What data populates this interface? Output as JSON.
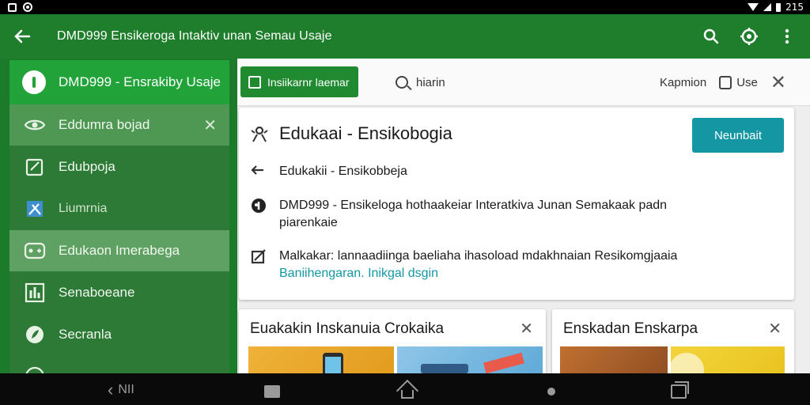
{
  "status_bar": {
    "time": "215"
  },
  "app_bar": {
    "title": "DMD999 Ensikeroga Intaktiv unan Semau Usaje",
    "icons": [
      "back-arrow-icon",
      "search-icon",
      "settings-icon",
      "more-vert-icon"
    ]
  },
  "sidebar": {
    "header_label": "DMD999 - Ensrakiby Usaje",
    "items": [
      {
        "label": "Eddumra bojad",
        "icon": "eye-icon",
        "closable": true
      },
      {
        "label": "Edubpoja",
        "icon": "edit-square-icon"
      },
      {
        "label": "Liumrnia",
        "icon": "tools-icon"
      },
      {
        "label": "Edukaon Imerabega",
        "icon": "gamepad-icon",
        "selected": true
      },
      {
        "label": "Senaboeane",
        "icon": "chart-icon"
      },
      {
        "label": "Secranla",
        "icon": "leaf-icon"
      }
    ]
  },
  "toolbar": {
    "primary_button": "Insiikarnr laemar",
    "search_text": "hiarin",
    "right_label": "Kapmion",
    "checkbox_label": "Use"
  },
  "detail": {
    "title": "Edukaai - Ensikobogia",
    "action_button": "Neunbait",
    "rows": [
      {
        "icon": "reply-icon",
        "text": "Edukakii - Ensikobbeja",
        "link": ""
      },
      {
        "icon": "info-icon",
        "text": "DMD999 - Ensikeloga hothaakeiar Interatkiva Junan Semakaak padn piarenkaie",
        "link": ""
      },
      {
        "icon": "crop-icon",
        "text": "Malkakar: lannaadiinga baeliaha ihasoload mdakhnaian Resikomgjaaia",
        "link": "Baniihengaran. Inikgal dsgin"
      }
    ]
  },
  "cards": [
    {
      "title": "Euakakin Inskanuia Crokaika"
    },
    {
      "title": "Enskadan Enskarpa"
    }
  ],
  "nav_bar": {
    "back_label": "NII"
  },
  "colors": {
    "app_bar": "#1e7e2b",
    "sidebar_header": "#21a33a",
    "accent_teal": "#1597a3",
    "link": "#1597a3"
  }
}
